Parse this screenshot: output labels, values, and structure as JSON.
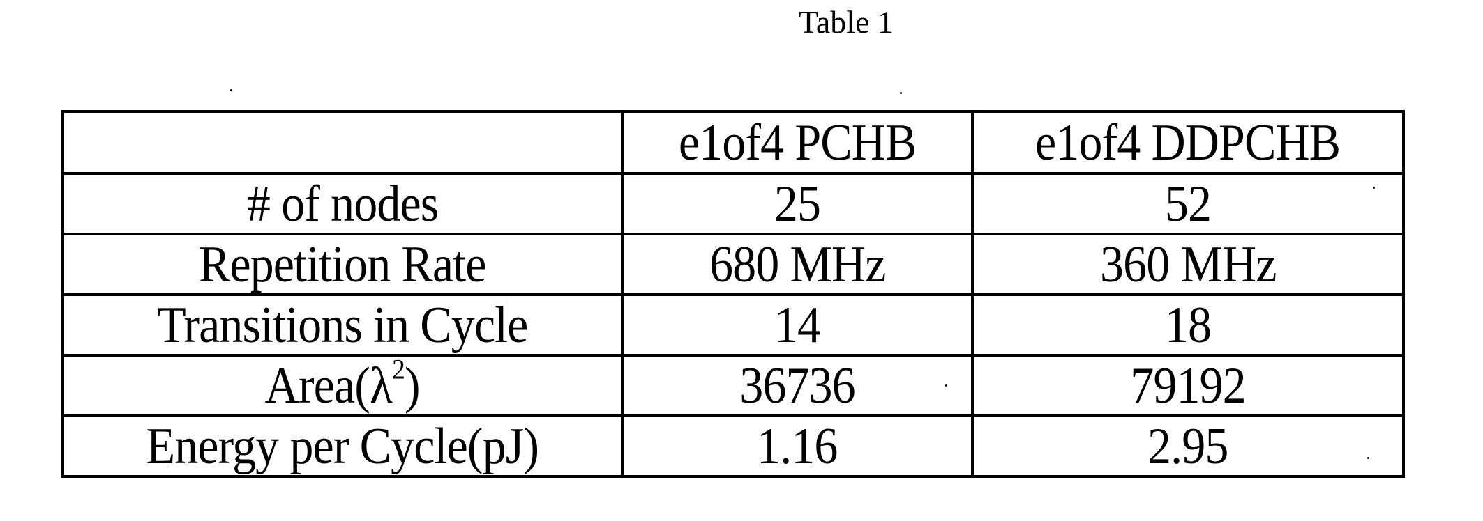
{
  "document": {
    "title": "Table 1"
  },
  "table": {
    "columns": [
      "",
      "e1of4 PCHB",
      "e1of4 DDPCHB"
    ],
    "rows": [
      {
        "label": "# of nodes",
        "values": [
          "25",
          "52"
        ]
      },
      {
        "label": "Repetition Rate",
        "values": [
          "680 MHz",
          "360 MHz"
        ]
      },
      {
        "label": "Transitions in Cycle",
        "values": [
          "14",
          "18"
        ]
      },
      {
        "label_main": "Area(λ",
        "label_sup": "2",
        "label_close": ")",
        "values": [
          "36736",
          "79192"
        ]
      },
      {
        "label": "Energy per Cycle(pJ)",
        "values": [
          "1.16",
          "2.95"
        ]
      }
    ]
  }
}
